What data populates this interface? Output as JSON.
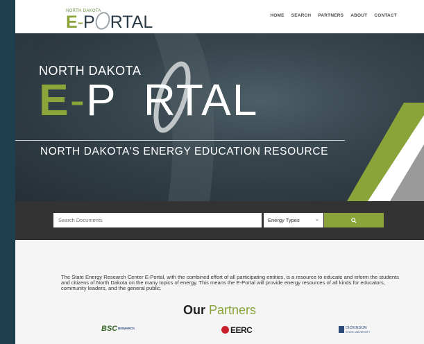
{
  "header": {
    "logo_small": "NORTH DAKOTA",
    "logo_main_e": "E",
    "logo_main_dash": "-",
    "logo_main_rest": "P",
    "logo_main_tail": "RTAL",
    "nav": [
      {
        "label": "HOME"
      },
      {
        "label": "SEARCH"
      },
      {
        "label": "PARTNERS"
      },
      {
        "label": "ABOUT"
      },
      {
        "label": "CONTACT"
      }
    ]
  },
  "hero": {
    "state": "NORTH DAKOTA",
    "title_e": "E",
    "title_dash": "-",
    "title_p": "P",
    "title_rest": "RTAL",
    "subtitle": "NORTH DAKOTA'S ENERGY EDUCATION RESOURCE"
  },
  "search": {
    "placeholder": "Search Documents",
    "energy_select": "Energy Types",
    "button_icon": "search-icon"
  },
  "about": {
    "text": "The State Energy Research Center E-Portal, with the combined effort of all participating entities, is a resource to educate and inform the students and citizens of North Dakota on the many topics of energy. This means the E-Portal will provide energy resources of all kinds for educators, community leaders, and the general public."
  },
  "partners": {
    "title_bold": "Our",
    "title_green": "Partners",
    "logos": [
      {
        "mark": "BSC",
        "text": "BISMARCK"
      },
      {
        "text": "EERC"
      },
      {
        "line1": "DICKINSON",
        "line2": "STATE UNIVERSITY"
      }
    ]
  },
  "colors": {
    "accent_green": "#8aa43a",
    "dark_band": "#333333",
    "frame": "#1f3f4f"
  }
}
